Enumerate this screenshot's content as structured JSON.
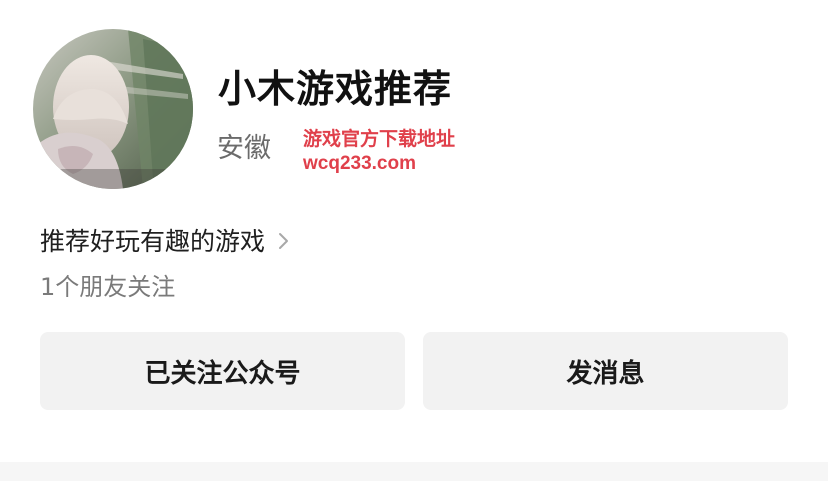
{
  "profile": {
    "name": "小木游戏推荐",
    "region": "安徽",
    "intro": "推荐好玩有趣的游戏",
    "friends_following": "1个朋友关注"
  },
  "promo": {
    "line1": "游戏官方下载地址",
    "line2": "wcq233.com",
    "color": "#e0404b"
  },
  "actions": {
    "follow_label": "已关注公众号",
    "message_label": "发消息"
  },
  "icons": {
    "intro_chevron": "chevron-right-icon"
  }
}
